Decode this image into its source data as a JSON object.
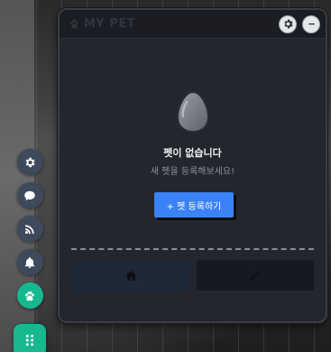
{
  "panel": {
    "title": "MY PET",
    "title_icon": "paw-icon",
    "settings_icon": "gear-icon",
    "minimize_icon": "minus-icon"
  },
  "empty_state": {
    "icon": "egg-icon",
    "title": "펫이 없습니다",
    "subtitle": "새 펫을 등록해보세요!",
    "register_button": "+ 펫 등록하기"
  },
  "tabs": [
    {
      "name": "home",
      "icon": "home-icon"
    },
    {
      "name": "edit",
      "icon": "pencil-icon"
    }
  ],
  "dock": {
    "items": [
      {
        "name": "settings",
        "icon": "gear-icon"
      },
      {
        "name": "chat",
        "icon": "chat-bubble-icon"
      },
      {
        "name": "feed",
        "icon": "rss-icon"
      },
      {
        "name": "notifications",
        "icon": "bell-icon"
      },
      {
        "name": "pet",
        "icon": "paw-icon",
        "active": true
      }
    ],
    "main_icon": "grid-icon"
  },
  "colors": {
    "accent": "#17b890",
    "primary_button": "#3b82f6",
    "panel_bg": "#23262c"
  }
}
